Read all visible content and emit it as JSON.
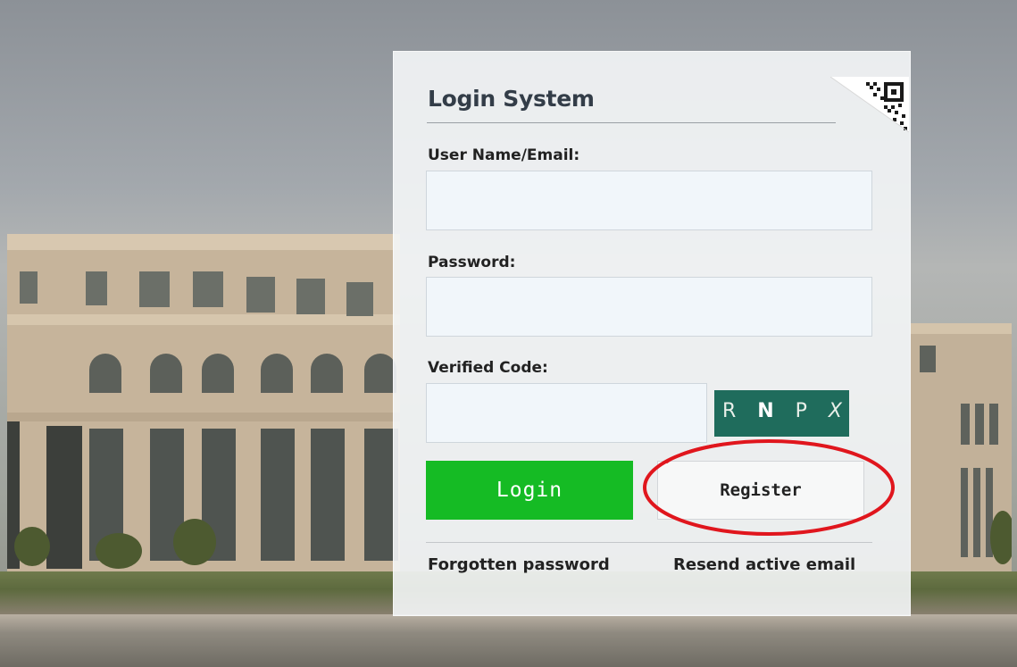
{
  "login": {
    "title": "Login System",
    "username": {
      "label": "User Name/Email:",
      "value": "",
      "placeholder": ""
    },
    "password": {
      "label": "Password:",
      "value": "",
      "placeholder": ""
    },
    "verify": {
      "label": "Verified Code:",
      "value": "",
      "placeholder": ""
    },
    "captcha": {
      "chars": [
        "R",
        "N",
        "P",
        "X"
      ]
    },
    "login_label": "Login",
    "register_label": "Register",
    "forgot_label": "Forgotten password",
    "resend_label": "Resend active email"
  },
  "icons": {
    "qr_corner": "qr-code-icon",
    "annotation": "red-ellipse-annotation"
  },
  "colors": {
    "login_button": "#15bb24",
    "captcha_bg": "#1f6c5c",
    "annotation": "#e0161d"
  }
}
